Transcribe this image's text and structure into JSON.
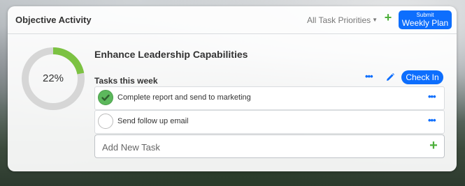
{
  "card": {
    "title": "Objective Activity",
    "priorities_label": "All Task Priorities",
    "submit": {
      "small": "Submit",
      "big": "Weekly Plan"
    }
  },
  "objective": {
    "title": "Enhance Leadership Capabilities",
    "progress_text": "22%",
    "progress_value": 0.22,
    "colors": {
      "progress": "#7cc242",
      "track": "#d6d6d6",
      "accent": "#0d6efd"
    }
  },
  "tasks_section": {
    "label": "Tasks this week",
    "checkin_label": "Check In",
    "tasks": [
      {
        "text": "Complete report and send to marketing",
        "done": true
      },
      {
        "text": "Send follow up email",
        "done": false
      }
    ]
  },
  "add_task": {
    "placeholder": "Add New Task"
  }
}
